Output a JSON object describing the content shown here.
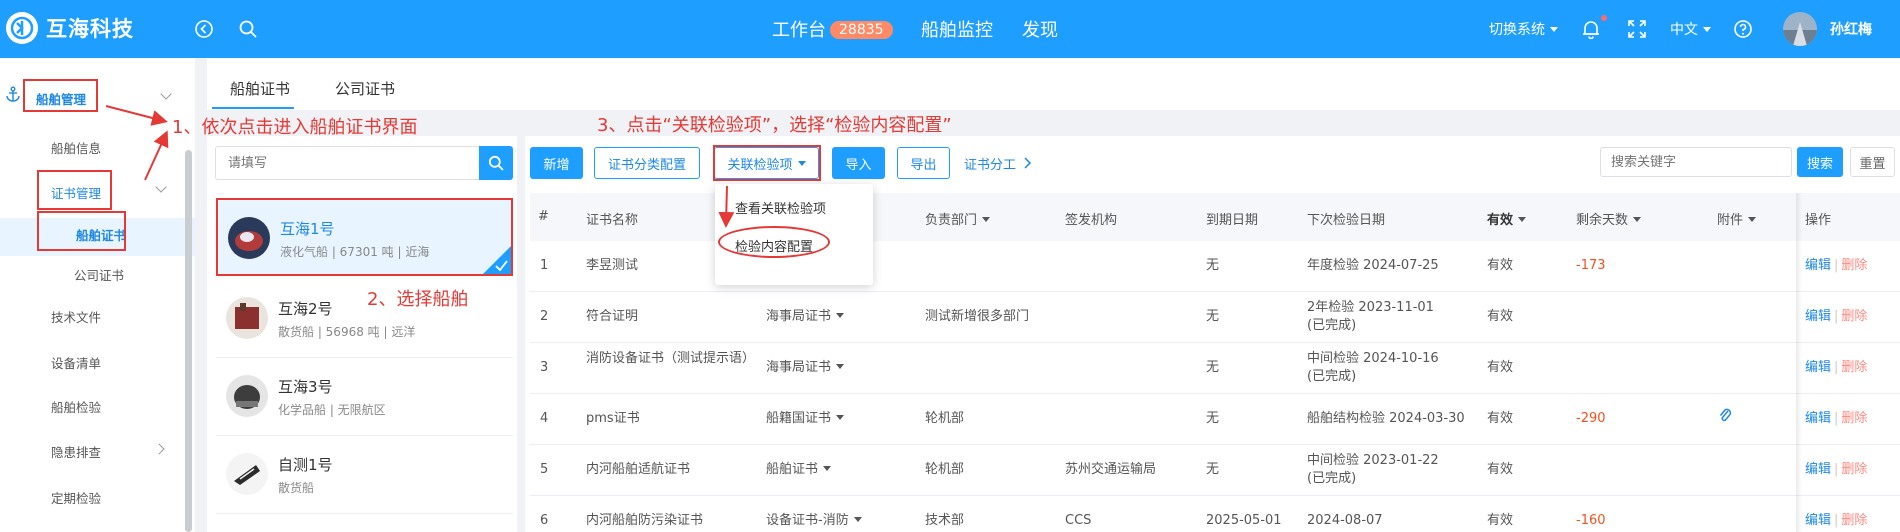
{
  "app": {
    "title": "互海科技"
  },
  "header": {
    "nav": [
      {
        "label": "工作台",
        "badge": "28835"
      },
      {
        "label": "船舶监控"
      },
      {
        "label": "发现"
      }
    ],
    "switch_system": "切换系统",
    "language": "中文",
    "user": "孙红梅"
  },
  "sidebar": {
    "items": [
      {
        "label": "船舶管理"
      },
      {
        "label": "船舶信息"
      },
      {
        "label": "证书管理"
      },
      {
        "label": "船舶证书"
      },
      {
        "label": "公司证书"
      },
      {
        "label": "技术文件"
      },
      {
        "label": "设备清单"
      },
      {
        "label": "船舶检验"
      },
      {
        "label": "隐患排查"
      },
      {
        "label": "定期检验"
      }
    ]
  },
  "tabs": [
    {
      "label": "船舶证书"
    },
    {
      "label": "公司证书"
    }
  ],
  "ship_search": {
    "placeholder": "请填写"
  },
  "ships": [
    {
      "name": "互海1号",
      "desc": "液化气船 | 67301 吨 | 近海"
    },
    {
      "name": "互海2号",
      "desc": "散货船 | 56968 吨 | 远洋"
    },
    {
      "name": "互海3号",
      "desc": "化学品船 | 无限航区"
    },
    {
      "name": "自测1号",
      "desc": "散货船"
    }
  ],
  "toolbar": {
    "add": "新增",
    "category_config": "证书分类配置",
    "link_inspection": "关联检验项",
    "import": "导入",
    "export": "导出",
    "division": "证书分工",
    "keyword_placeholder": "搜索关键字",
    "search": "搜索",
    "reset": "重置"
  },
  "dropdown": {
    "items": [
      {
        "label": "查看关联检验项"
      },
      {
        "label": "检验内容配置"
      }
    ]
  },
  "table": {
    "headers": {
      "idx": "#",
      "name": "证书名称",
      "dept": "负责部门",
      "issuer": "签发机构",
      "expire": "到期日期",
      "next": "下次检验日期",
      "valid": "有效",
      "remain": "剩余天数",
      "attach": "附件",
      "ops": "操作"
    },
    "ops": {
      "edit": "编辑",
      "del": "删除"
    },
    "rows": [
      {
        "idx": "1",
        "name": "李昱测试",
        "type": "",
        "dept": "",
        "issuer": "",
        "expire": "无",
        "next": "年度检验 2024-07-25",
        "valid": "有效",
        "remain": "-173"
      },
      {
        "idx": "2",
        "name": "符合证明",
        "type": "海事局证书",
        "dept": "测试新增很多部门",
        "issuer": "",
        "expire": "无",
        "next": "2年检验 2023-11-01\n(已完成)",
        "valid": "有效",
        "remain": ""
      },
      {
        "idx": "3",
        "name": "消防设备证书（测试提示语）",
        "type": "海事局证书",
        "dept": "",
        "issuer": "",
        "expire": "无",
        "next": "中间检验 2024-10-16\n(已完成)",
        "valid": "有效",
        "remain": ""
      },
      {
        "idx": "4",
        "name": "pms证书",
        "type": "船籍国证书",
        "dept": "轮机部",
        "issuer": "",
        "expire": "无",
        "next": "船舶结构检验 2024-03-30",
        "valid": "有效",
        "remain": "-290"
      },
      {
        "idx": "5",
        "name": "内河船舶适航证书",
        "type": "船舶证书",
        "dept": "轮机部",
        "issuer": "苏州交通运输局",
        "expire": "无",
        "next": "中间检验 2023-01-22\n(已完成)",
        "valid": "有效",
        "remain": ""
      },
      {
        "idx": "6",
        "name": "内河船舶防污染证书",
        "type": "设备证书-消防",
        "dept": "技术部",
        "issuer": "CCS",
        "expire": "2025-05-01",
        "next": "2024-08-07",
        "valid": "有效",
        "remain": "-160"
      }
    ]
  },
  "annotations": {
    "step1": "1、依次点击进入船舶证书界面",
    "step2": "2、选择船舶",
    "step3": "3、点击“关联检验项”，选择“检验内容配置”"
  },
  "colors": {
    "primary": "#1e9fff",
    "annotation": "#e53935",
    "negative": "#f4511e",
    "badge": "#ff8a65"
  }
}
